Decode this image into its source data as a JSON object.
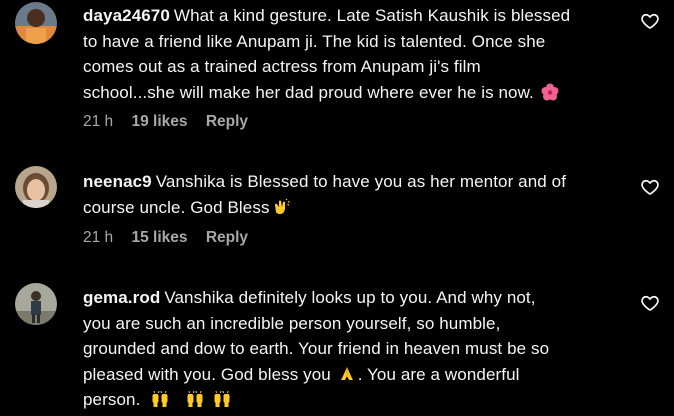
{
  "comments": [
    {
      "username": "daya24670",
      "lines": [
        "What a kind gesture. Late Satish Kaushik is blessed",
        "to have a friend like Anupam ji. The kid is talented. Once she",
        "comes out as a trained actress from Anupam ji's film",
        "school...she will make her dad proud where ever he is now."
      ],
      "emoji_end": "hibiscus-emoji",
      "time": "21 h",
      "likes": "19 likes",
      "reply": "Reply",
      "like_icon": "heart-outline-icon"
    },
    {
      "username": "neenac9",
      "lines": [
        "Vanshika is Blessed to have you as her mentor and of",
        "course uncle. God Bless"
      ],
      "emoji_end": "clapping-hands-emoji",
      "time": "21 h",
      "likes": "15 likes",
      "reply": "Reply",
      "like_icon": "heart-outline-icon"
    },
    {
      "username": "gema.rod",
      "lines": [
        "Vanshika definitely looks up to you. And why not,",
        "you are such an incredible person yourself, so humble,",
        "grounded and dow to earth. Your friend in heaven must be so",
        "pleased with you. God bless you",
        ". You are a wonderful",
        "person."
      ],
      "emoji_mid": "folded-hands-emoji",
      "emoji_end": "raising-hands-emoji",
      "like_icon": "heart-outline-icon"
    }
  ],
  "colors": {
    "background": "#000000",
    "text": "#f5f5f5",
    "muted": "#a8a8a8"
  }
}
